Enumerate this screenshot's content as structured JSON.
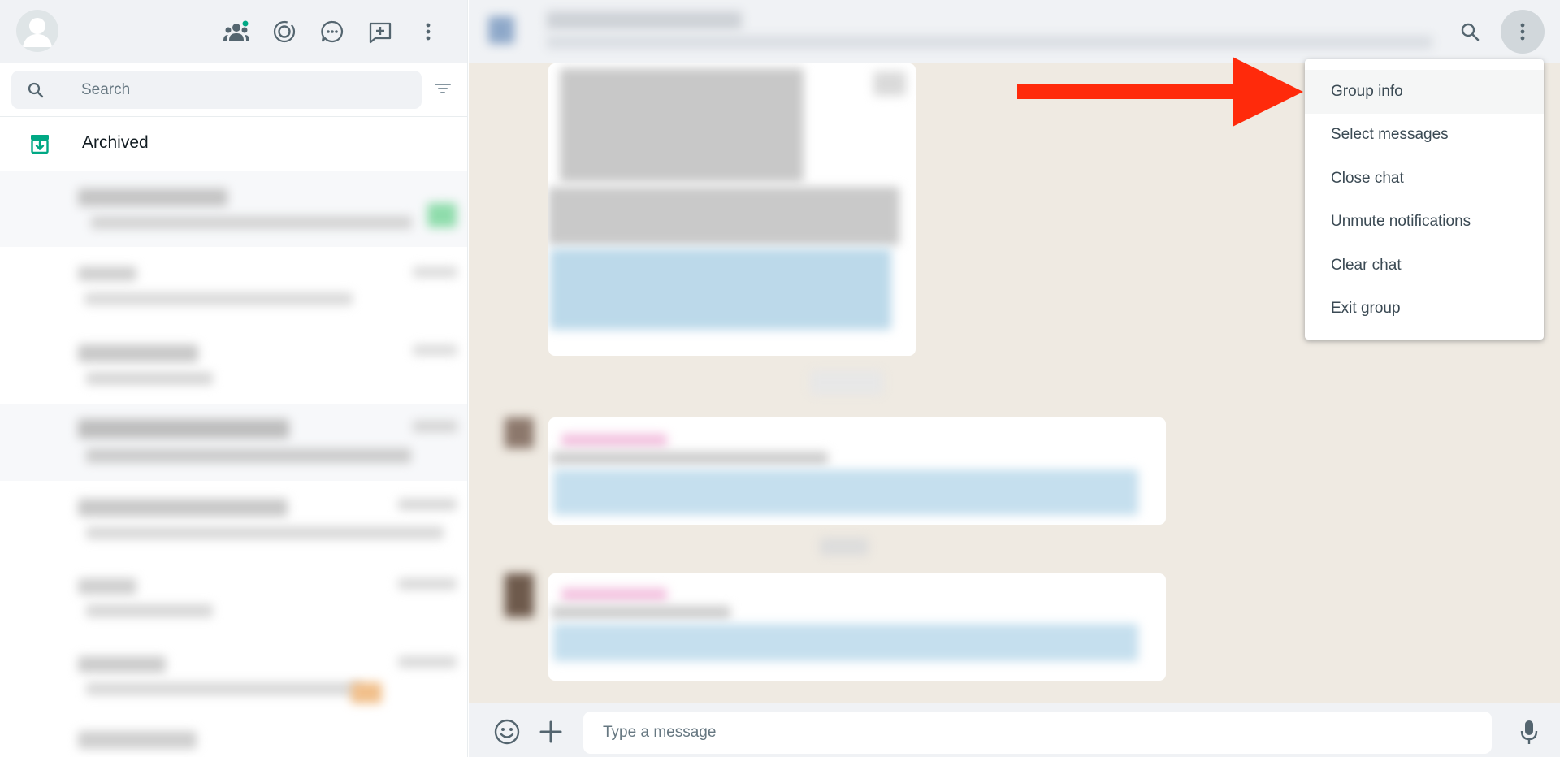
{
  "sidebar": {
    "header": {
      "icons": [
        "default-avatar",
        "communities-icon",
        "status-icon",
        "channels-icon",
        "new-chat-icon",
        "more-options-icon"
      ]
    },
    "search": {
      "placeholder": "Search"
    },
    "filter_icon": "filter-icon",
    "archived": {
      "label": "Archived",
      "icon": "archive-icon"
    },
    "colors": {
      "accent": "#00a884",
      "panel_header_bg": "#f0f2f5"
    }
  },
  "chat": {
    "header": {
      "icons": [
        "search-icon",
        "more-options-icon"
      ]
    },
    "composer": {
      "placeholder": "Type a message",
      "icons": [
        "emoji-icon",
        "attach-plus-icon",
        "microphone-icon"
      ]
    },
    "colors": {
      "wallpaper": "#efeae2"
    }
  },
  "menu": {
    "items": [
      {
        "label": "Group info"
      },
      {
        "label": "Select messages"
      },
      {
        "label": "Close chat"
      },
      {
        "label": "Unmute notifications"
      },
      {
        "label": "Clear chat"
      },
      {
        "label": "Exit group"
      }
    ]
  },
  "annotation": {
    "arrow_color": "#ff2a0b"
  }
}
